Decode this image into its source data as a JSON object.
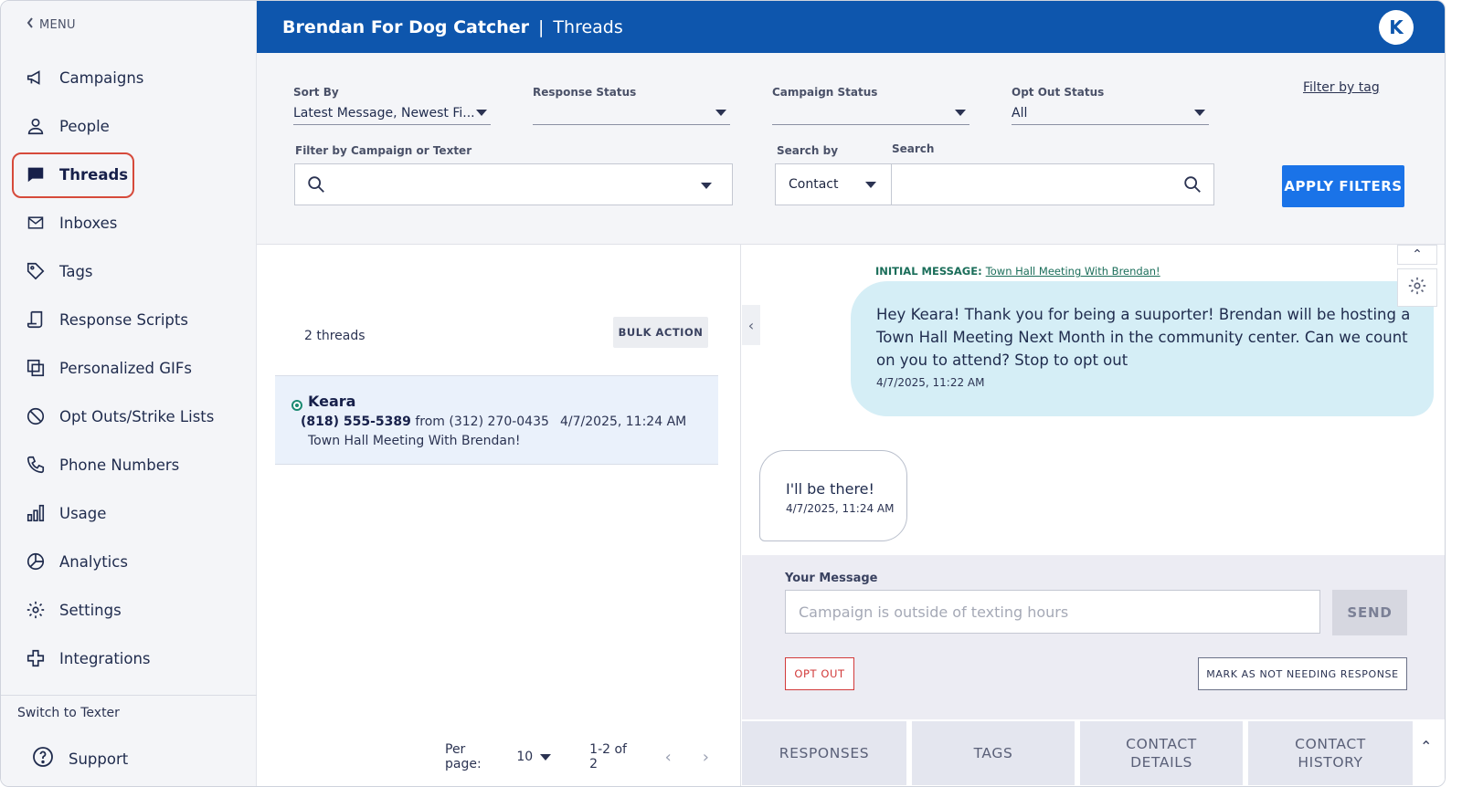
{
  "sidebar": {
    "menu_label": "MENU",
    "items": [
      {
        "label": "Campaigns"
      },
      {
        "label": "People"
      },
      {
        "label": "Threads"
      },
      {
        "label": "Inboxes"
      },
      {
        "label": "Tags"
      },
      {
        "label": "Response Scripts"
      },
      {
        "label": "Personalized GIFs"
      },
      {
        "label": "Opt Outs/Strike Lists"
      },
      {
        "label": "Phone Numbers"
      },
      {
        "label": "Usage"
      },
      {
        "label": "Analytics"
      },
      {
        "label": "Settings"
      },
      {
        "label": "Integrations"
      }
    ],
    "active_item": "Threads",
    "switch_texter": "Switch to Texter",
    "support": "Support"
  },
  "header": {
    "campaign_name": "Brendan For Dog Catcher",
    "separator": "|",
    "page_title": "Threads",
    "avatar_initial": "K",
    "colors": {
      "bar": "#0e56ad",
      "accent": "#1a73e8"
    }
  },
  "filters": {
    "sort_by": {
      "label": "Sort By",
      "value": "Latest Message, Newest Fi..."
    },
    "response_status": {
      "label": "Response Status",
      "value": ""
    },
    "campaign_status": {
      "label": "Campaign Status",
      "value": ""
    },
    "opt_out_status": {
      "label": "Opt Out Status",
      "value": "All"
    },
    "filter_by_tag": "Filter by tag",
    "campaign_or_texter": {
      "label": "Filter by Campaign or Texter",
      "value": ""
    },
    "search_by": {
      "label": "Search by",
      "value": "Contact"
    },
    "search": {
      "label": "Search",
      "value": ""
    },
    "apply_button": "APPLY FILTERS"
  },
  "thread_list": {
    "count_text": "2 threads",
    "bulk_action": "BULK ACTION",
    "threads": [
      {
        "name": "Keara",
        "contact_phone": "(818) 555-5389",
        "from_word": "from",
        "from_phone": "(312) 270-0435",
        "timestamp": "4/7/2025, 11:24 AM",
        "campaign": "Town Hall Meeting With Brendan!"
      }
    ],
    "pagination": {
      "per_page_label": "Per page:",
      "per_page_value": "10",
      "range": "1-2 of 2"
    }
  },
  "conversation": {
    "initial_label": "INITIAL MESSAGE:",
    "initial_campaign_link": "Town Hall Meeting With Brendan!",
    "messages": [
      {
        "direction": "outgoing",
        "text": "Hey Keara! Thank you for being a suuporter! Brendan will be hosting a Town Hall Meeting Next Month in the community center. Can we count on you to attend? Stop to opt out",
        "timestamp": "4/7/2025, 11:22 AM"
      },
      {
        "direction": "incoming",
        "text": "I'll be there!",
        "timestamp": "4/7/2025, 11:24 AM"
      }
    ]
  },
  "composer": {
    "label": "Your Message",
    "placeholder": "Campaign is outside of texting hours",
    "send": "SEND",
    "opt_out": "OPT OUT",
    "mark_not_needing": "MARK AS NOT NEEDING RESPONSE"
  },
  "bottom_tabs": [
    "RESPONSES",
    "TAGS",
    "CONTACT DETAILS",
    "CONTACT HISTORY"
  ]
}
